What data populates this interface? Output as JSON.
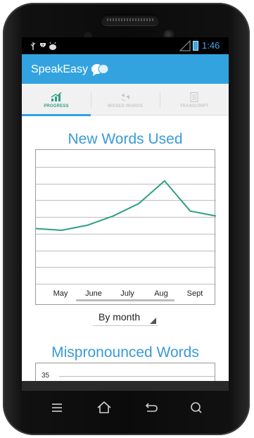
{
  "status_bar": {
    "left_icons": [
      "usb-icon",
      "wifi-question-icon",
      "android-icon"
    ],
    "time": "1:46"
  },
  "app": {
    "title": "SpeakEasy",
    "brand_color": "#33a3e0"
  },
  "tabs": [
    {
      "label": "PROGRESS",
      "icon": "progress-chart-icon",
      "active": true
    },
    {
      "label": "MISSED WORDS",
      "icon": "missed-words-icon",
      "active": false
    },
    {
      "label": "TRANSCRIPT",
      "icon": "transcript-icon",
      "active": false
    }
  ],
  "chart_title": "New Words Used",
  "filter": {
    "selected": "By month"
  },
  "chart2_title": "Mispronounced Words",
  "chart_data": [
    {
      "type": "line",
      "title": "New Words Used",
      "categories": [
        "May",
        "June",
        "July",
        "Aug",
        "Sept"
      ],
      "x": [
        "",
        "May",
        "",
        "June",
        "",
        "July",
        "",
        "Aug",
        "",
        "Sept",
        ""
      ],
      "series": [
        {
          "values": [
            6.6,
            6.4,
            7.0,
            8.1,
            9.6,
            12.3,
            8.7,
            8.1
          ],
          "color": "#2f9e84"
        }
      ],
      "ylim": [
        0,
        16
      ],
      "grid": true
    },
    {
      "type": "line",
      "title": "Mispronounced Words",
      "y_ticks": [
        35
      ],
      "grid": true
    }
  ],
  "nav": [
    {
      "icon": "menu-icon"
    },
    {
      "icon": "home-icon"
    },
    {
      "icon": "back-icon"
    },
    {
      "icon": "search-icon"
    }
  ]
}
